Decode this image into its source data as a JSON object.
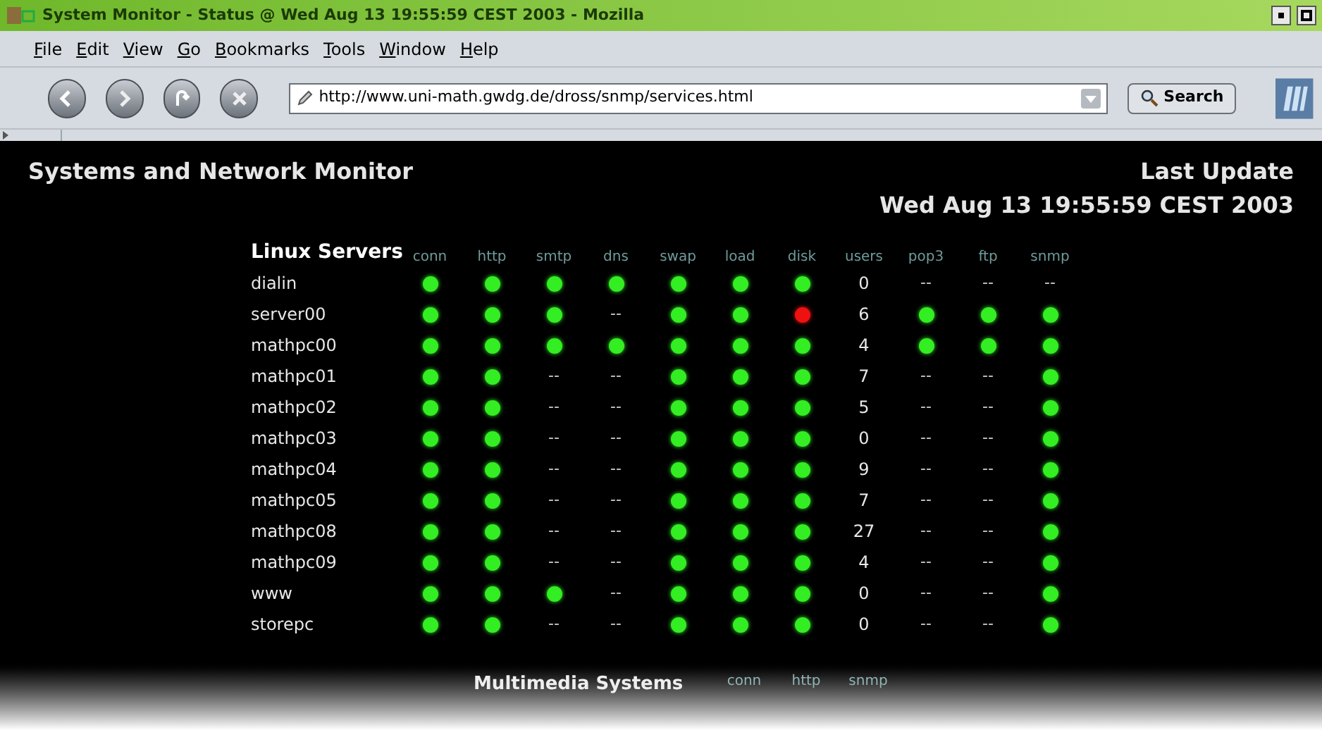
{
  "window": {
    "title": "System Monitor - Status @ Wed Aug 13 19:55:59 CEST 2003 - Mozilla"
  },
  "menu": [
    "File",
    "Edit",
    "View",
    "Go",
    "Bookmarks",
    "Tools",
    "Window",
    "Help"
  ],
  "toolbar": {
    "url": "http://www.uni-math.gwdg.de/dross/snmp/services.html",
    "search_button": "Search"
  },
  "page": {
    "title": "Systems and Network Monitor",
    "update_label": "Last Update",
    "update_time": "Wed Aug 13 19:55:59 CEST 2003"
  },
  "sections": [
    {
      "title": "Linux Servers",
      "columns": [
        "conn",
        "http",
        "smtp",
        "dns",
        "swap",
        "load",
        "disk",
        "users",
        "pop3",
        "ftp",
        "snmp"
      ],
      "rows": [
        {
          "name": "dialin",
          "cells": [
            {
              "kind": "dot",
              "color": "#33ee22"
            },
            {
              "kind": "dot",
              "color": "#33ee22"
            },
            {
              "kind": "dot",
              "color": "#33ee22"
            },
            {
              "kind": "dot",
              "color": "#33ee22"
            },
            {
              "kind": "dot",
              "color": "#33ee22"
            },
            {
              "kind": "dot",
              "color": "#33ee22"
            },
            {
              "kind": "dot",
              "color": "#33ee22"
            },
            {
              "kind": "number",
              "text": "0"
            },
            {
              "kind": "text",
              "text": "--"
            },
            {
              "kind": "text",
              "text": "--"
            },
            {
              "kind": "text",
              "text": "--"
            }
          ]
        },
        {
          "name": "server00",
          "cells": [
            {
              "kind": "dot",
              "color": "#33ee22"
            },
            {
              "kind": "dot",
              "color": "#33ee22"
            },
            {
              "kind": "dot",
              "color": "#33ee22"
            },
            {
              "kind": "text",
              "text": "--"
            },
            {
              "kind": "dot",
              "color": "#33ee22"
            },
            {
              "kind": "dot",
              "color": "#33ee22"
            },
            {
              "kind": "dot",
              "color": "#ee1111"
            },
            {
              "kind": "number",
              "text": "6"
            },
            {
              "kind": "dot",
              "color": "#33ee22"
            },
            {
              "kind": "dot",
              "color": "#33ee22"
            },
            {
              "kind": "dot",
              "color": "#33ee22"
            }
          ]
        },
        {
          "name": "mathpc00",
          "cells": [
            {
              "kind": "dot",
              "color": "#33ee22"
            },
            {
              "kind": "dot",
              "color": "#33ee22"
            },
            {
              "kind": "dot",
              "color": "#33ee22"
            },
            {
              "kind": "dot",
              "color": "#33ee22"
            },
            {
              "kind": "dot",
              "color": "#33ee22"
            },
            {
              "kind": "dot",
              "color": "#33ee22"
            },
            {
              "kind": "dot",
              "color": "#33ee22"
            },
            {
              "kind": "number",
              "text": "4"
            },
            {
              "kind": "dot",
              "color": "#33ee22"
            },
            {
              "kind": "dot",
              "color": "#33ee22"
            },
            {
              "kind": "dot",
              "color": "#33ee22"
            }
          ]
        },
        {
          "name": "mathpc01",
          "cells": [
            {
              "kind": "dot",
              "color": "#33ee22"
            },
            {
              "kind": "dot",
              "color": "#33ee22"
            },
            {
              "kind": "text",
              "text": "--"
            },
            {
              "kind": "text",
              "text": "--"
            },
            {
              "kind": "dot",
              "color": "#33ee22"
            },
            {
              "kind": "dot",
              "color": "#33ee22"
            },
            {
              "kind": "dot",
              "color": "#33ee22"
            },
            {
              "kind": "number",
              "text": "7"
            },
            {
              "kind": "text",
              "text": "--"
            },
            {
              "kind": "text",
              "text": "--"
            },
            {
              "kind": "dot",
              "color": "#33ee22"
            }
          ]
        },
        {
          "name": "mathpc02",
          "cells": [
            {
              "kind": "dot",
              "color": "#33ee22"
            },
            {
              "kind": "dot",
              "color": "#33ee22"
            },
            {
              "kind": "text",
              "text": "--"
            },
            {
              "kind": "text",
              "text": "--"
            },
            {
              "kind": "dot",
              "color": "#33ee22"
            },
            {
              "kind": "dot",
              "color": "#33ee22"
            },
            {
              "kind": "dot",
              "color": "#33ee22"
            },
            {
              "kind": "number",
              "text": "5"
            },
            {
              "kind": "text",
              "text": "--"
            },
            {
              "kind": "text",
              "text": "--"
            },
            {
              "kind": "dot",
              "color": "#33ee22"
            }
          ]
        },
        {
          "name": "mathpc03",
          "cells": [
            {
              "kind": "dot",
              "color": "#33ee22"
            },
            {
              "kind": "dot",
              "color": "#33ee22"
            },
            {
              "kind": "text",
              "text": "--"
            },
            {
              "kind": "text",
              "text": "--"
            },
            {
              "kind": "dot",
              "color": "#33ee22"
            },
            {
              "kind": "dot",
              "color": "#33ee22"
            },
            {
              "kind": "dot",
              "color": "#33ee22"
            },
            {
              "kind": "number",
              "text": "0"
            },
            {
              "kind": "text",
              "text": "--"
            },
            {
              "kind": "text",
              "text": "--"
            },
            {
              "kind": "dot",
              "color": "#33ee22"
            }
          ]
        },
        {
          "name": "mathpc04",
          "cells": [
            {
              "kind": "dot",
              "color": "#33ee22"
            },
            {
              "kind": "dot",
              "color": "#33ee22"
            },
            {
              "kind": "text",
              "text": "--"
            },
            {
              "kind": "text",
              "text": "--"
            },
            {
              "kind": "dot",
              "color": "#33ee22"
            },
            {
              "kind": "dot",
              "color": "#33ee22"
            },
            {
              "kind": "dot",
              "color": "#33ee22"
            },
            {
              "kind": "number",
              "text": "9"
            },
            {
              "kind": "text",
              "text": "--"
            },
            {
              "kind": "text",
              "text": "--"
            },
            {
              "kind": "dot",
              "color": "#33ee22"
            }
          ]
        },
        {
          "name": "mathpc05",
          "cells": [
            {
              "kind": "dot",
              "color": "#33ee22"
            },
            {
              "kind": "dot",
              "color": "#33ee22"
            },
            {
              "kind": "text",
              "text": "--"
            },
            {
              "kind": "text",
              "text": "--"
            },
            {
              "kind": "dot",
              "color": "#33ee22"
            },
            {
              "kind": "dot",
              "color": "#33ee22"
            },
            {
              "kind": "dot",
              "color": "#33ee22"
            },
            {
              "kind": "number",
              "text": "7"
            },
            {
              "kind": "text",
              "text": "--"
            },
            {
              "kind": "text",
              "text": "--"
            },
            {
              "kind": "dot",
              "color": "#33ee22"
            }
          ]
        },
        {
          "name": "mathpc08",
          "cells": [
            {
              "kind": "dot",
              "color": "#33ee22"
            },
            {
              "kind": "dot",
              "color": "#33ee22"
            },
            {
              "kind": "text",
              "text": "--"
            },
            {
              "kind": "text",
              "text": "--"
            },
            {
              "kind": "dot",
              "color": "#33ee22"
            },
            {
              "kind": "dot",
              "color": "#33ee22"
            },
            {
              "kind": "dot",
              "color": "#33ee22"
            },
            {
              "kind": "number",
              "text": "27"
            },
            {
              "kind": "text",
              "text": "--"
            },
            {
              "kind": "text",
              "text": "--"
            },
            {
              "kind": "dot",
              "color": "#33ee22"
            }
          ]
        },
        {
          "name": "mathpc09",
          "cells": [
            {
              "kind": "dot",
              "color": "#33ee22"
            },
            {
              "kind": "dot",
              "color": "#33ee22"
            },
            {
              "kind": "text",
              "text": "--"
            },
            {
              "kind": "text",
              "text": "--"
            },
            {
              "kind": "dot",
              "color": "#33ee22"
            },
            {
              "kind": "dot",
              "color": "#33ee22"
            },
            {
              "kind": "dot",
              "color": "#33ee22"
            },
            {
              "kind": "number",
              "text": "4"
            },
            {
              "kind": "text",
              "text": "--"
            },
            {
              "kind": "text",
              "text": "--"
            },
            {
              "kind": "dot",
              "color": "#33ee22"
            }
          ]
        },
        {
          "name": "www",
          "cells": [
            {
              "kind": "dot",
              "color": "#33ee22"
            },
            {
              "kind": "dot",
              "color": "#33ee22"
            },
            {
              "kind": "dot",
              "color": "#33ee22"
            },
            {
              "kind": "text",
              "text": "--"
            },
            {
              "kind": "dot",
              "color": "#33ee22"
            },
            {
              "kind": "dot",
              "color": "#33ee22"
            },
            {
              "kind": "dot",
              "color": "#33ee22"
            },
            {
              "kind": "number",
              "text": "0"
            },
            {
              "kind": "text",
              "text": "--"
            },
            {
              "kind": "text",
              "text": "--"
            },
            {
              "kind": "dot",
              "color": "#33ee22"
            }
          ]
        },
        {
          "name": "storepc",
          "cells": [
            {
              "kind": "dot",
              "color": "#33ee22"
            },
            {
              "kind": "dot",
              "color": "#33ee22"
            },
            {
              "kind": "text",
              "text": "--"
            },
            {
              "kind": "text",
              "text": "--"
            },
            {
              "kind": "dot",
              "color": "#33ee22"
            },
            {
              "kind": "dot",
              "color": "#33ee22"
            },
            {
              "kind": "dot",
              "color": "#33ee22"
            },
            {
              "kind": "number",
              "text": "0"
            },
            {
              "kind": "text",
              "text": "--"
            },
            {
              "kind": "text",
              "text": "--"
            },
            {
              "kind": "dot",
              "color": "#33ee22"
            }
          ]
        }
      ]
    },
    {
      "title": "Multimedia Systems",
      "columns": [
        "conn",
        "http",
        "snmp"
      ]
    }
  ]
}
